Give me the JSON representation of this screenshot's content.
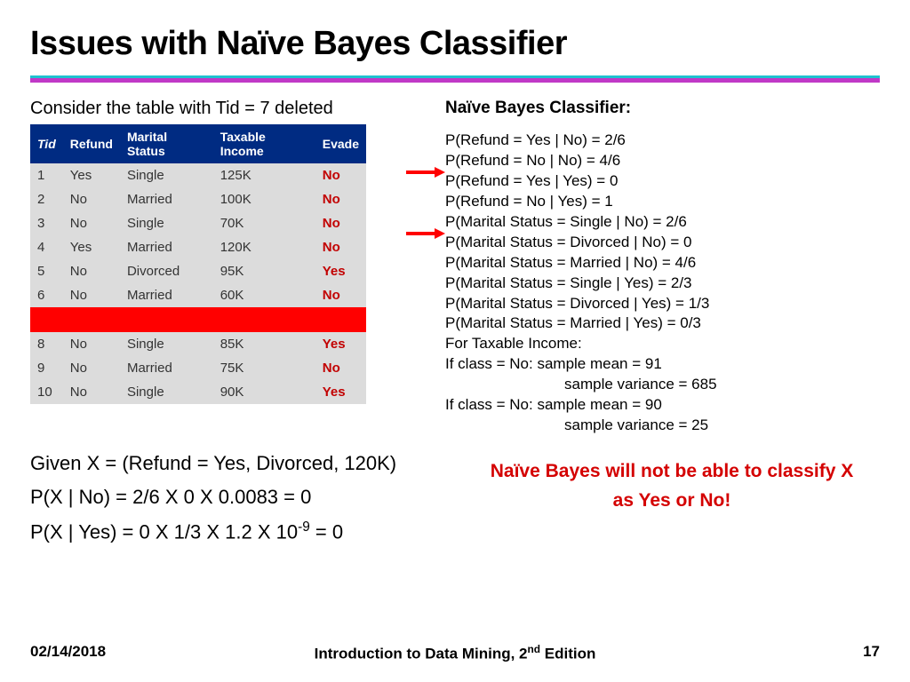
{
  "title": "Issues with Naïve Bayes Classifier",
  "lead": "Consider the table with Tid = 7 deleted",
  "table": {
    "headers": {
      "tid": "Tid",
      "refund": "Refund",
      "marital": "Marital Status",
      "income": "Taxable Income",
      "evade": "Evade"
    },
    "rows": [
      {
        "tid": "1",
        "refund": "Yes",
        "marital": "Single",
        "income": "125K",
        "evade": "No"
      },
      {
        "tid": "2",
        "refund": "No",
        "marital": "Married",
        "income": "100K",
        "evade": "No"
      },
      {
        "tid": "3",
        "refund": "No",
        "marital": "Single",
        "income": "70K",
        "evade": "No"
      },
      {
        "tid": "4",
        "refund": "Yes",
        "marital": "Married",
        "income": "120K",
        "evade": "No"
      },
      {
        "tid": "5",
        "refund": "No",
        "marital": "Divorced",
        "income": "95K",
        "evade": "Yes"
      },
      {
        "tid": "6",
        "refund": "No",
        "marital": "Married",
        "income": "60K",
        "evade": "No"
      },
      {
        "deleted": true
      },
      {
        "tid": "8",
        "refund": "No",
        "marital": "Single",
        "income": "85K",
        "evade": "Yes"
      },
      {
        "tid": "9",
        "refund": "No",
        "marital": "Married",
        "income": "75K",
        "evade": "No"
      },
      {
        "tid": "10",
        "refund": "No",
        "marital": "Single",
        "income": "90K",
        "evade": "Yes"
      }
    ]
  },
  "nbc": {
    "heading": "Naïve  Bayes Classifier:",
    "lines": [
      "P(Refund = Yes | No) = 2/6",
      "P(Refund = No | No) = 4/6",
      "P(Refund = Yes | Yes) = 0",
      "P(Refund = No | Yes) = 1",
      "P(Marital Status = Single | No) = 2/6",
      "P(Marital Status = Divorced | No) = 0",
      "P(Marital Status = Married | No) = 4/6",
      "P(Marital Status = Single | Yes) = 2/3",
      "P(Marital Status = Divorced | Yes) = 1/3",
      "P(Marital Status = Married | Yes) = 0/3",
      "For Taxable Income:",
      "If class = No: sample mean = 91",
      "sample variance = 685",
      "If class = No: sample mean = 90",
      "sample variance = 25"
    ]
  },
  "bottom": {
    "given": "Given X = (Refund = Yes, Divorced, 120K)",
    "p_no": "P(X | No) = 2/6 X 0 X 0.0083 = 0",
    "p_yes_prefix": "P(X | Yes) = 0 X 1/3 X 1.2 X 10",
    "p_yes_exp": "-9",
    "p_yes_suffix": " = 0"
  },
  "warn": "Naïve Bayes will not be able to classify X as Yes or No!",
  "footer": {
    "date": "02/14/2018",
    "book_prefix": "Introduction to Data Mining, 2",
    "book_sup": "nd",
    "book_suffix": " Edition",
    "page": "17"
  },
  "colors": {
    "arrow": "#ff0000"
  }
}
